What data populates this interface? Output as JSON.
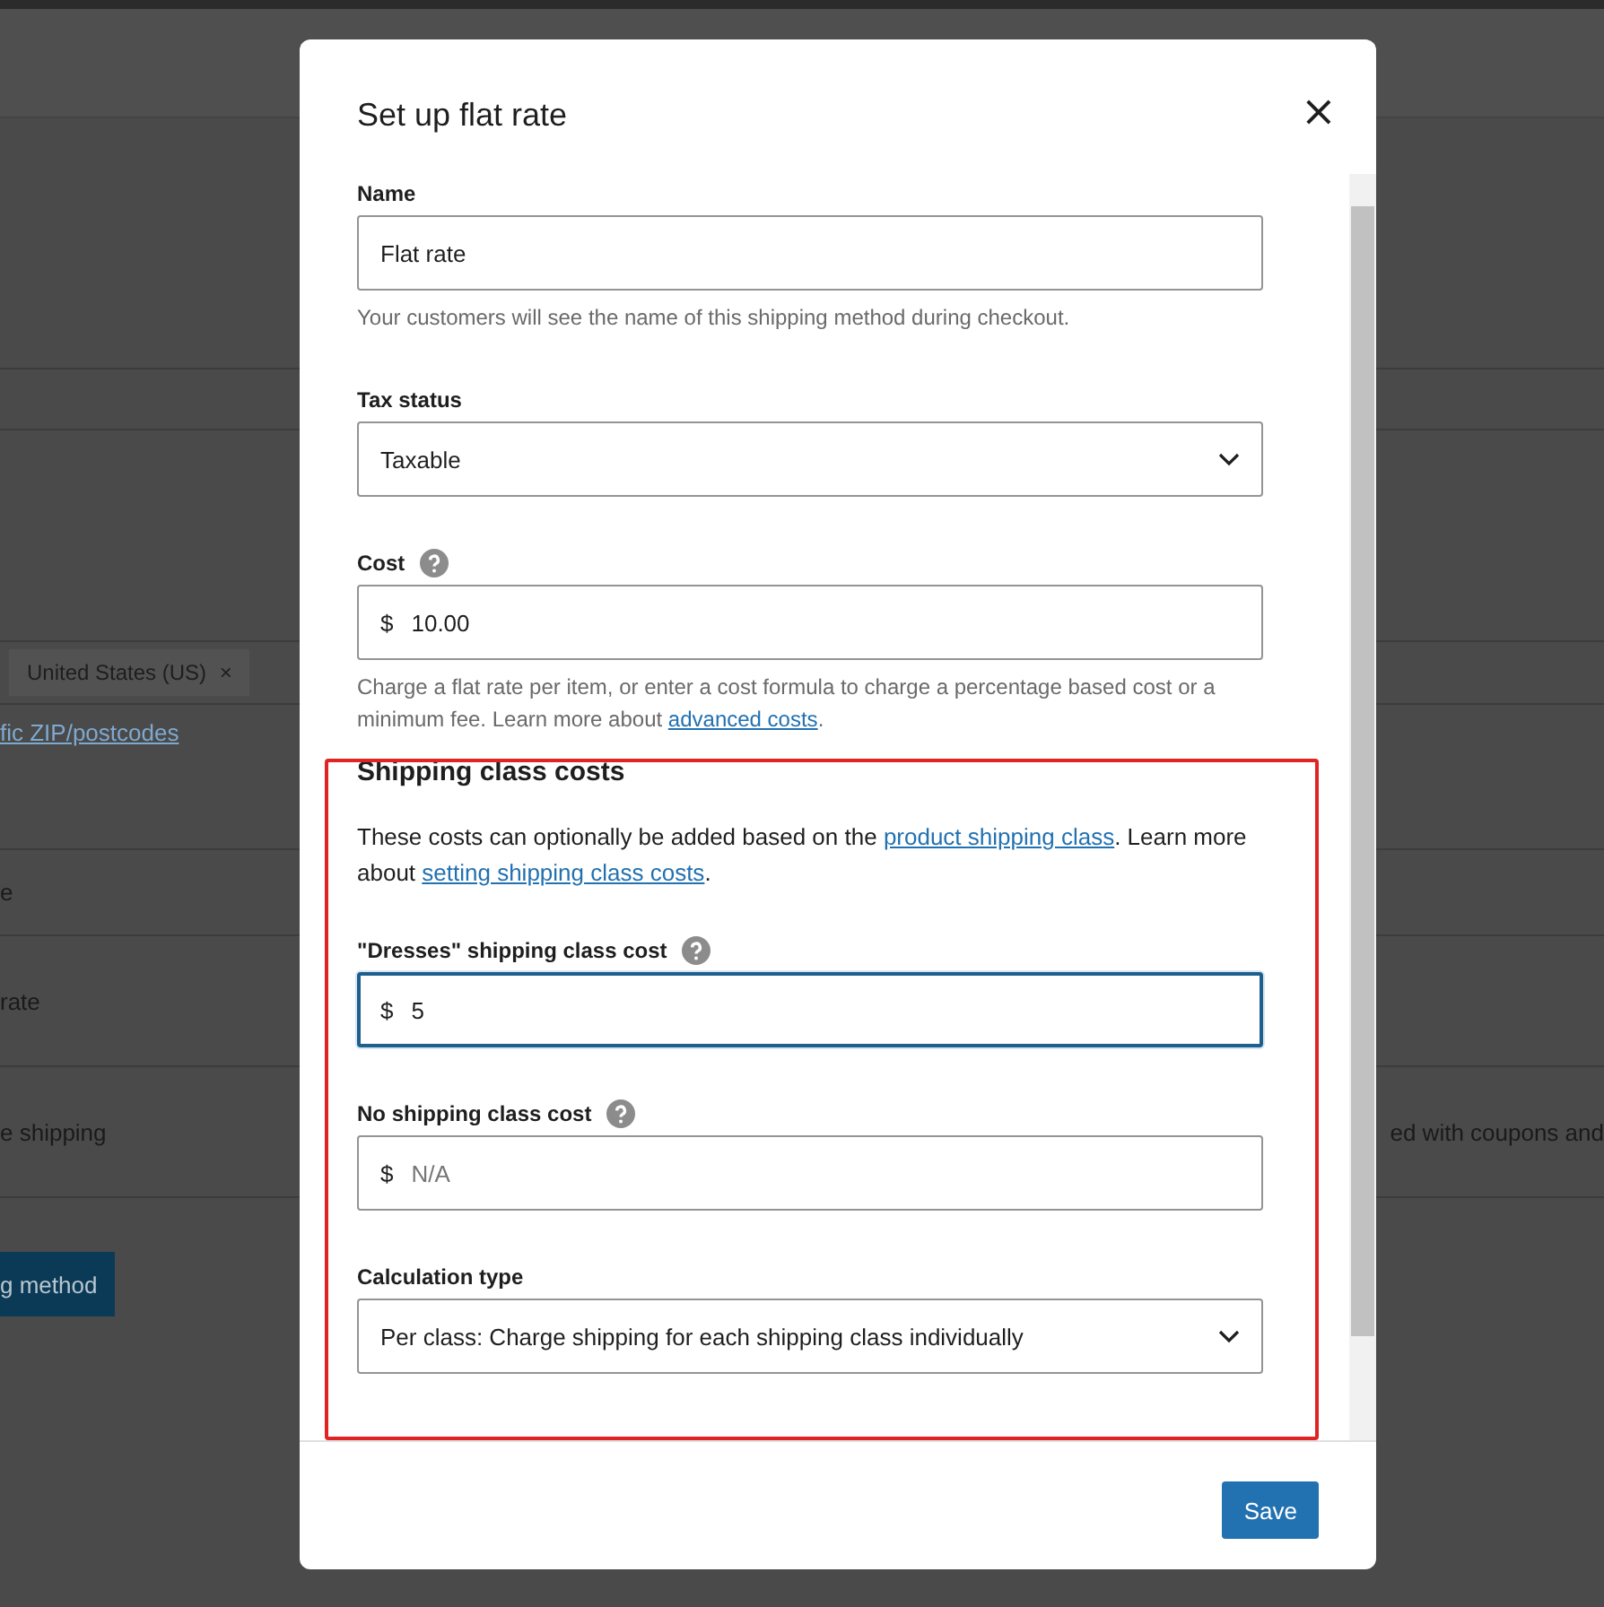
{
  "background_page": {
    "tag": {
      "label": "United States (US)",
      "remove": "×"
    },
    "link": "fic ZIP/postcodes",
    "rows": [
      {
        "label": "e",
        "note": ""
      },
      {
        "label": "rate",
        "note": ""
      },
      {
        "label": "e shipping",
        "note": "ed with coupons and"
      }
    ],
    "button": "g method"
  },
  "modal": {
    "title": "Set up flat rate",
    "close": "×",
    "fields": [
      {
        "kind": "text",
        "label": "Name",
        "help_icon": false,
        "value": "Flat rate",
        "focused": false,
        "help": [
          {
            "text": "Your customers will see the name of this shipping method during checkout."
          }
        ]
      },
      {
        "kind": "select",
        "label": "Tax status",
        "help_icon": false,
        "value": "Taxable",
        "focused": false
      },
      {
        "kind": "currency",
        "label": "Cost",
        "help_icon": true,
        "prefix": "$",
        "value": "10.00",
        "focused": false,
        "help": [
          {
            "text": "Charge a flat rate per item, or enter a cost formula to charge a percentage based cost or a minimum fee. Learn more about "
          },
          {
            "link": "advanced costs"
          },
          {
            "text": "."
          }
        ]
      }
    ],
    "section": {
      "title": "Shipping class costs",
      "description": [
        {
          "text": "These costs can optionally be added based on the "
        },
        {
          "link": "product shipping class"
        },
        {
          "text": ". Learn more about "
        },
        {
          "link": "setting shipping class costs"
        },
        {
          "text": "."
        }
      ],
      "fields": [
        {
          "kind": "currency",
          "label": "\"Dresses\" shipping class cost",
          "help_icon": true,
          "prefix": "$",
          "value": "5",
          "focused": true
        },
        {
          "kind": "currency",
          "label": "No shipping class cost",
          "help_icon": true,
          "prefix": "$",
          "placeholder": "N/A",
          "focused": false
        },
        {
          "kind": "select",
          "label": "Calculation type",
          "help_icon": false,
          "value": "Per class: Charge shipping for each shipping class individually",
          "focused": false
        }
      ]
    },
    "save": "Save"
  }
}
